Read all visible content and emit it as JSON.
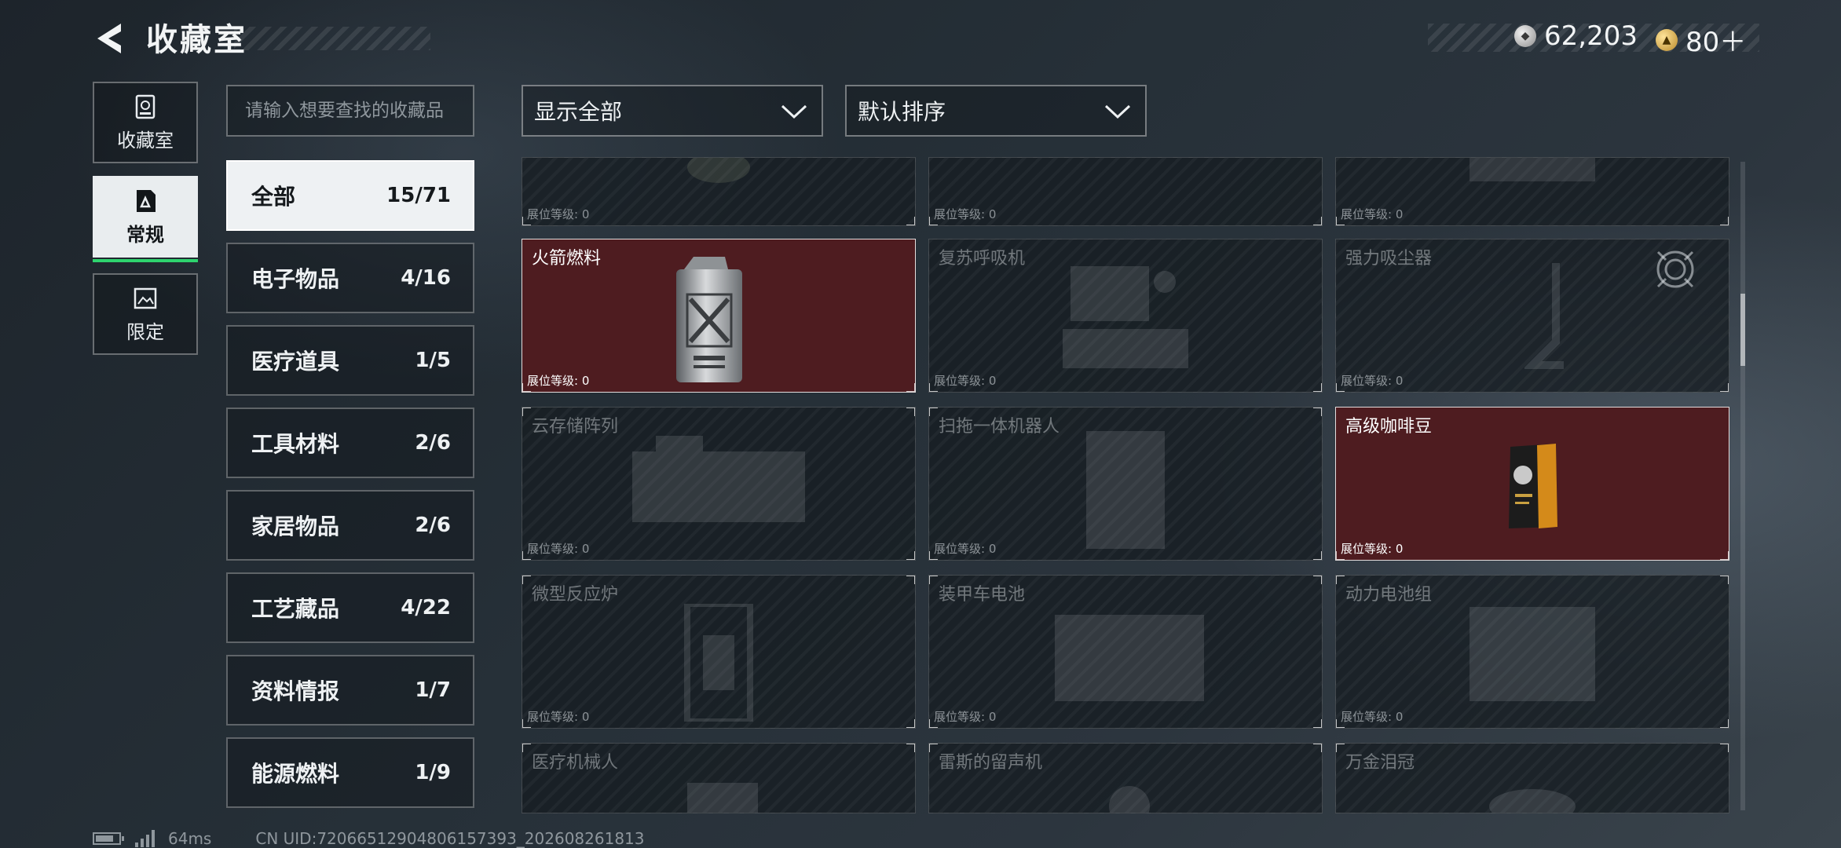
{
  "header": {
    "title": "收藏室",
    "currency": [
      {
        "icon": "silver-coin-icon",
        "value": "62,203"
      },
      {
        "icon": "gold-coin-icon",
        "value": "80＋"
      }
    ]
  },
  "side_tabs": [
    {
      "label": "收藏室",
      "icon": "vault-icon",
      "active": false
    },
    {
      "label": "常规",
      "icon": "document-icon",
      "active": true
    },
    {
      "label": "限定",
      "icon": "picture-icon",
      "active": false
    }
  ],
  "search": {
    "placeholder": "请输入想要查找的收藏品"
  },
  "filters": {
    "display": "显示全部",
    "sort": "默认排序"
  },
  "categories": [
    {
      "name": "全部",
      "count": "15/71",
      "active": true
    },
    {
      "name": "电子物品",
      "count": "4/16",
      "active": false
    },
    {
      "name": "医疗道具",
      "count": "1/5",
      "active": false
    },
    {
      "name": "工具材料",
      "count": "2/6",
      "active": false
    },
    {
      "name": "家居物品",
      "count": "2/6",
      "active": false
    },
    {
      "name": "工艺藏品",
      "count": "4/22",
      "active": false
    },
    {
      "name": "资料情报",
      "count": "1/7",
      "active": false
    },
    {
      "name": "能源燃料",
      "count": "1/9",
      "active": false
    }
  ],
  "level_label": "展位等级: 0",
  "items": [
    {
      "name": "",
      "owned": false
    },
    {
      "name": "",
      "owned": false
    },
    {
      "name": "",
      "owned": false
    },
    {
      "name": "火箭燃料",
      "owned": true
    },
    {
      "name": "复苏呼吸机",
      "owned": false
    },
    {
      "name": "强力吸尘器",
      "owned": false
    },
    {
      "name": "云存储阵列",
      "owned": false
    },
    {
      "name": "扫拖一体机器人",
      "owned": false
    },
    {
      "name": "高级咖啡豆",
      "owned": true
    },
    {
      "name": "微型反应炉",
      "owned": false
    },
    {
      "name": "装甲车电池",
      "owned": false
    },
    {
      "name": "动力电池组",
      "owned": false
    },
    {
      "name": "医疗机械人",
      "owned": false
    },
    {
      "name": "雷斯的留声机",
      "owned": false
    },
    {
      "name": "万金泪冠",
      "owned": false
    }
  ],
  "footer": {
    "ping": "64ms",
    "uid": "CN UID:7206651290480615​7393_202608261813"
  }
}
